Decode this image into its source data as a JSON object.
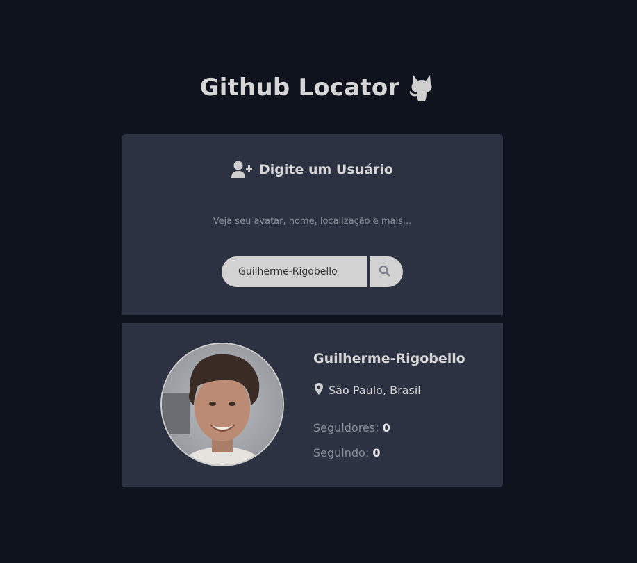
{
  "header": {
    "title": "Github Locator",
    "icon": "github-octocat-icon"
  },
  "search": {
    "heading": "Digite um Usuário",
    "heading_icon": "user-plus-icon",
    "description": "Veja seu avatar, nome, localização e mais...",
    "input_value": "Guilherme-Rigobello",
    "button_icon": "search-icon"
  },
  "profile": {
    "name": "Guilherme-Rigobello",
    "location_icon": "map-marker-icon",
    "location": "São Paulo, Brasil",
    "followers_label": "Seguidores:",
    "followers_count": "0",
    "following_label": "Seguindo:",
    "following_count": "0"
  },
  "colors": {
    "background": "#0f131d",
    "card": "#2c3241",
    "text": "#d6d6d6",
    "muted": "#8a8f9b",
    "input": "#d2d2d2"
  }
}
